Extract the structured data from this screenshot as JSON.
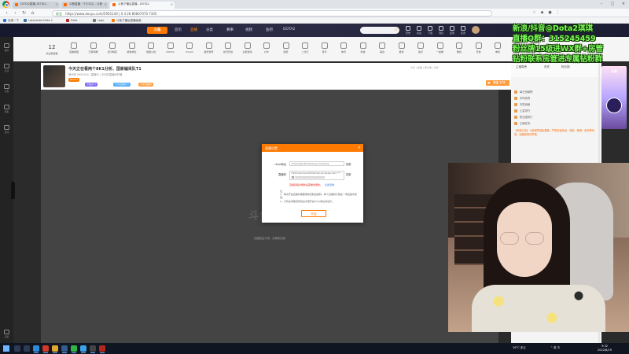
{
  "browser": {
    "tabs": [
      {
        "label": "DOTA2直播_DOTA2视频直播在线观看",
        "color": "#ff6600"
      },
      {
        "label": "斗鱼 - 每个人的直播平台",
        "color": "#ff7a00"
      },
      {
        "label": "Liquipedia Dota 2",
        "color": "#3a6ea5"
      },
      {
        "label": "斗鱼 | 每个人的直播平台",
        "color": "#ff7a00"
      }
    ],
    "visible_tab_labels": [
      "DOTA2直播_DOTA2...",
      "斗鱼直播 - 个人中心 - 斗鱼",
      "斗鱼下播后直播...DOTA2"
    ],
    "url_secure_label": "安全",
    "url": "https://www.douyu.com/5955140 | 0 4 28 80807070 7305",
    "bookmarks": [
      {
        "label": "百度一下",
        "color": "#2f6fe0"
      },
      {
        "label": "Liquipedia Dota 2",
        "color": "#3a6ea5"
      },
      {
        "label": "Dota",
        "color": "#b3261e"
      },
      {
        "label": "Logo",
        "color": "#777777"
      },
      {
        "label": "斗鱼下播后直播画面",
        "color": "#ff7a00"
      }
    ]
  },
  "site_nav": {
    "logo": "斗鱼",
    "items": [
      "首页",
      "直播",
      "分类",
      "赛事",
      "视频",
      "鱼吧",
      "DOTA2"
    ],
    "active_index": 1,
    "icons": [
      "历史",
      "关注",
      "下载",
      "消息",
      "签到",
      "任务",
      "等级"
    ]
  },
  "leftbar": {
    "items": [
      "推荐",
      "关注",
      "分类",
      "赛事",
      "游戏"
    ],
    "bottom_items": [
      "设置"
    ]
  },
  "categories": {
    "count_value": "12",
    "count_label": "关注频道数",
    "items": [
      "英雄联盟",
      "王者荣耀",
      "和平精英",
      "绝地求生",
      "穿越火线",
      "DOTA2",
      "CS:GO",
      "魔兽世界",
      "炉石传说",
      "主机游戏",
      "户外",
      "颜值",
      "二次元",
      "音乐",
      "体育",
      "科技",
      "美食",
      "星秀",
      "鱼乐",
      "一起看",
      "数码",
      "手游",
      "单机",
      "综合",
      "更多分类"
    ]
  },
  "room": {
    "title": "今天正在看两个8K1分析、国家编采队T1",
    "meta": "房间号 5955140 | 直播中 | 今天的直播间开播",
    "tags": [
      {
        "label": "DOTA2",
        "color": "#ff7a00"
      },
      {
        "label": "小鱼丸 5",
        "color": "#7c6cf1"
      },
      {
        "label": "分享直播间 5",
        "color": "#4dabf7"
      },
      {
        "label": "分享直播间",
        "color": "#ff9c3c"
      }
    ],
    "follow_label": "关注",
    "follow_count": "176",
    "tip_label": "赠送",
    "right_icons": "分享 | 举报 | 客户端 | 房管"
  },
  "player": {
    "message": "如遇延迟卡顿，请刷新页面",
    "watermark": "斗鱼"
  },
  "rightpanel": {
    "tabs": [
      "主播周榜",
      "贵宾",
      "粉丝团"
    ],
    "rows": [
      "每日贡献榜",
      "本场贵宾",
      "本周贡献",
      "土豪排行",
      "粉丝团排行",
      "主播任务"
    ],
    "notice": "【系统公告】斗鱼倡导绿色直播，严禁涉及政治、低俗、赌博、色情等内容，如遇违规请举报。"
  },
  "overlay": {
    "lines": [
      "新浪/抖音@Dota2琪琪",
      "直播Q群：315245459",
      "粉丝牌15级进WX群+房管",
      "钻粉联系房管进专属钻粉群"
    ],
    "promo_title": "斗鱼"
  },
  "modal": {
    "title": "直播设置",
    "close_glyph": "×",
    "fields": [
      {
        "label": "rtmp地址",
        "value": "rtmp://sendtc3a.douyu.com/live",
        "action": "复制"
      },
      {
        "label": "直播码",
        "value": "5955140rVaVuFpMAYXqUw?wsSecret=***",
        "action": "复制"
      }
    ],
    "dropdown_value": "选择线路",
    "warning": "直播码每次刷新后需重新更新。",
    "warning_link": "点此复制",
    "notes_title": "注：",
    "notes": [
      "1、每次开启直播时需要重新复制直播码，每个直播码只能在一场直播中使用。",
      "2、只有在你推流成功后才能开启rtmp地址并显示。"
    ],
    "button": "开始"
  },
  "taskbar": {
    "apps": [
      {
        "name": "search",
        "color": "#2d3a56"
      },
      {
        "name": "task-view",
        "color": "#2d3a56"
      },
      {
        "name": "edge",
        "color": "#2f8bd8"
      },
      {
        "name": "netease",
        "color": "#d23a2a"
      },
      {
        "name": "chrome",
        "color": "#e0a82e"
      },
      {
        "name": "steam",
        "color": "#335c8c"
      },
      {
        "name": "wechat",
        "color": "#2fb548"
      },
      {
        "name": "qq",
        "color": "#3ba3e8"
      },
      {
        "name": "obs",
        "color": "#444444"
      },
      {
        "name": "dota",
        "color": "#b3261e"
      }
    ],
    "temperature": "36°C 多云",
    "tray": "^  英  中",
    "time": "9:32",
    "date": "2022/8/19"
  },
  "colors": {
    "accent": "#ff7a00",
    "player_bg": "#444444",
    "overlay_green": "#7cff5a"
  }
}
